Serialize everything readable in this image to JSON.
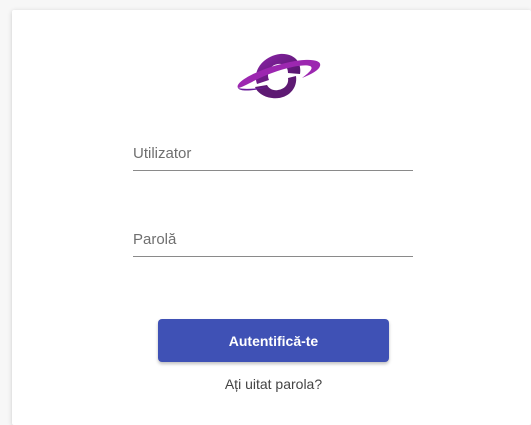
{
  "login": {
    "username_placeholder": "Utilizator",
    "password_placeholder": "Parolă",
    "submit_label": "Autentifică-te",
    "forgot_password_label": "Ați uitat parola?"
  },
  "icons": {
    "logo": "planet-logo-icon"
  },
  "colors": {
    "primary_button": "#3f51b5",
    "logo_purple": "#7b1fa2",
    "logo_dark": "#4a1460"
  }
}
